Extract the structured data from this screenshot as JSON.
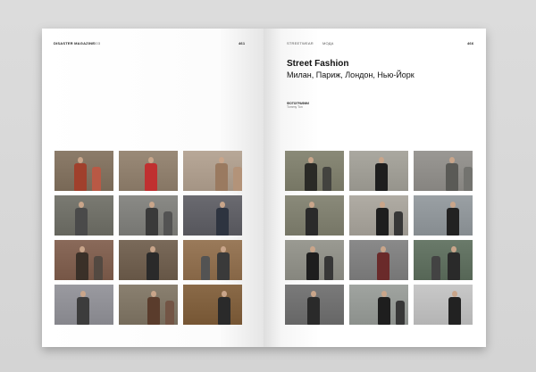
{
  "magazine": {
    "left_header": "DISASTER MAGAZINE",
    "left_issue": "003",
    "left_page": "461",
    "right_section": "STREETWEAR",
    "right_category": "МОДА",
    "right_page": "466"
  },
  "article": {
    "title": "Street Fashion",
    "subtitle": "Милан, Париж, Лондон, Нью-Йорк",
    "credit_label": "ФОТОГРАФИИ",
    "credit_name": "Tommy Ton"
  },
  "photo_palette": {
    "left": [
      [
        "#8c7c6a",
        "#a0402c"
      ],
      [
        "#9a8a78",
        "#c03030"
      ],
      [
        "#b8a898",
        "#9a7a60"
      ],
      [
        "#7a7a72",
        "#4a4a4a"
      ],
      [
        "#8a8a86",
        "#3a3a3a"
      ],
      [
        "#6a6a70",
        "#2e3440"
      ],
      [
        "#8a6a5a",
        "#3a3028"
      ],
      [
        "#7a6a5a",
        "#2a2a2a"
      ],
      [
        "#9a7a5a",
        "#3a3a3a"
      ],
      [
        "#9a9aa0",
        "#3c3c3c"
      ],
      [
        "#8a8070",
        "#5a3c2c"
      ],
      [
        "#8a6a48",
        "#2a2a2a"
      ]
    ],
    "right": [
      [
        "#8a8a78",
        "#2a2a26"
      ],
      [
        "#aaa8a0",
        "#1e1e1e"
      ],
      [
        "#9a9894",
        "#5a5a56"
      ],
      [
        "#8a8a7a",
        "#2a2a2a"
      ],
      [
        "#b0aca4",
        "#1e1e1e"
      ],
      [
        "#9aa0a4",
        "#222222"
      ],
      [
        "#9a9a92",
        "#1e1e1e"
      ],
      [
        "#8a8a8a",
        "#6a2a2a"
      ],
      [
        "#6a7a6a",
        "#2a2a2a"
      ],
      [
        "#7a7a7a",
        "#2a2a2a"
      ],
      [
        "#a0a4a0",
        "#1e1e1e"
      ],
      [
        "#c8c8c8",
        "#222222"
      ]
    ]
  }
}
